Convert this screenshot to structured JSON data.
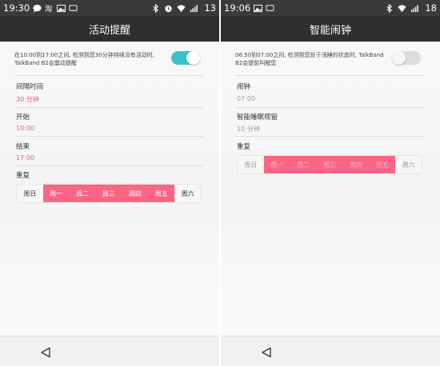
{
  "left": {
    "status": {
      "time": "19:30",
      "battery": "13"
    },
    "title": "活动提醒",
    "description": "在10:00到17:00之间, 检测到您30分钟持续没有活动时, TalkBand B2会震动提醒",
    "toggle_state": "on",
    "fields": [
      {
        "label": "间隔时间",
        "value": "30 分钟"
      },
      {
        "label": "开始",
        "value": "10:00"
      },
      {
        "label": "结束",
        "value": "17:00"
      }
    ],
    "repeat_label": "重复",
    "days": [
      {
        "label": "周日",
        "selected": false
      },
      {
        "label": "周一",
        "selected": true
      },
      {
        "label": "周二",
        "selected": true
      },
      {
        "label": "周三",
        "selected": true
      },
      {
        "label": "周四",
        "selected": true
      },
      {
        "label": "周五",
        "selected": true
      },
      {
        "label": "周六",
        "selected": false
      }
    ]
  },
  "right": {
    "status": {
      "time": "19:06",
      "battery": "18"
    },
    "title": "智能闹钟",
    "description": "06:50到07:00之间, 检测到您处于浅睡的状态时, TalkBand B2会提前叫醒您",
    "toggle_state": "off",
    "fields": [
      {
        "label": "闹钟",
        "value": "07:00"
      },
      {
        "label": "智能睡眠视窗",
        "value": "10 分钟"
      }
    ],
    "repeat_label": "重复",
    "days": [
      {
        "label": "周日",
        "selected": false
      },
      {
        "label": "周一",
        "selected": true
      },
      {
        "label": "周二",
        "selected": true
      },
      {
        "label": "周三",
        "selected": true
      },
      {
        "label": "周四",
        "selected": true
      },
      {
        "label": "周五",
        "selected": true
      },
      {
        "label": "周六",
        "selected": false
      }
    ]
  },
  "colors": {
    "accent_teal": "#38c5c9",
    "accent_pink": "#fd6585",
    "value_pink": "#f05a79",
    "titlebar": "#2e2e30"
  },
  "icons": [
    "chat-bubble-icon",
    "taobao-icon",
    "image-icon",
    "screen-icon",
    "bluetooth-icon",
    "alarm-icon",
    "wifi-icon",
    "signal-icon",
    "back-icon"
  ]
}
